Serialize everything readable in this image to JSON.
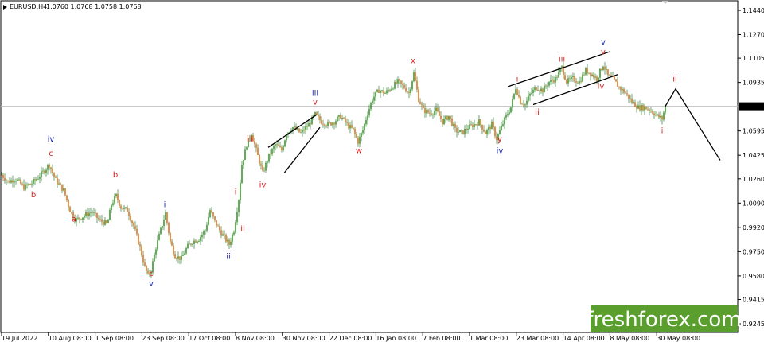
{
  "header": {
    "symbol": "EURUSD,H4",
    "ohlc": "1.0760 1.0768 1.0758 1.0768"
  },
  "brand": {
    "text": "freshforex.com"
  },
  "chart_data": {
    "type": "candlestick",
    "ylim": [
      0.9245,
      1.144
    ],
    "y_ticks": [
      "1.1440",
      "1.1270",
      "1.1105",
      "1.0935",
      "1.0768",
      "1.0595",
      "1.0425",
      "1.0260",
      "1.0090",
      "0.9920",
      "0.9750",
      "0.9580",
      "0.9415",
      "0.9245"
    ],
    "current_price": "1.0768",
    "x_ticks": [
      "19 Jul 2022",
      "10 Aug 08:00",
      "1 Sep 08:00",
      "23 Sep 08:00",
      "17 Oct 08:00",
      "8 Nov 08:00",
      "30 Nov 08:00",
      "22 Dec 08:00",
      "16 Jan 08:00",
      "7 Feb 08:00",
      "1 Mar 08:00",
      "23 Mar 08:00",
      "14 Apr 08:00",
      "8 May 08:00",
      "30 May 08:00"
    ],
    "price_path": [
      [
        0,
        1.03
      ],
      [
        10,
        1.024
      ],
      [
        20,
        1.026
      ],
      [
        30,
        1.02
      ],
      [
        40,
        1.023
      ],
      [
        50,
        1.028
      ],
      [
        62,
        1.036
      ],
      [
        70,
        1.025
      ],
      [
        80,
        1.018
      ],
      [
        88,
        1.004
      ],
      [
        95,
        0.997
      ],
      [
        105,
        1.0
      ],
      [
        115,
        1.003
      ],
      [
        125,
        0.997
      ],
      [
        135,
        0.994
      ],
      [
        140,
        1.008
      ],
      [
        146,
        1.014
      ],
      [
        152,
        1.006
      ],
      [
        160,
        1.004
      ],
      [
        168,
        0.993
      ],
      [
        176,
        0.978
      ],
      [
        182,
        0.964
      ],
      [
        186,
        0.958
      ],
      [
        190,
        0.962
      ],
      [
        196,
        0.978
      ],
      [
        202,
        0.99
      ],
      [
        208,
        1.002
      ],
      [
        214,
        0.982
      ],
      [
        220,
        0.972
      ],
      [
        228,
        0.97
      ],
      [
        235,
        0.978
      ],
      [
        242,
        0.982
      ],
      [
        250,
        0.984
      ],
      [
        258,
        0.99
      ],
      [
        264,
        1.004
      ],
      [
        270,
        0.996
      ],
      [
        278,
        0.988
      ],
      [
        288,
        0.98
      ],
      [
        294,
        0.99
      ],
      [
        300,
        1.012
      ],
      [
        304,
        1.036
      ],
      [
        310,
        1.05
      ],
      [
        316,
        1.058
      ],
      [
        322,
        1.046
      ],
      [
        330,
        1.03
      ],
      [
        338,
        1.042
      ],
      [
        346,
        1.05
      ],
      [
        354,
        1.046
      ],
      [
        360,
        1.058
      ],
      [
        368,
        1.062
      ],
      [
        378,
        1.058
      ],
      [
        388,
        1.064
      ],
      [
        396,
        1.071
      ],
      [
        404,
        1.066
      ],
      [
        412,
        1.064
      ],
      [
        420,
        1.066
      ],
      [
        428,
        1.07
      ],
      [
        436,
        1.064
      ],
      [
        444,
        1.06
      ],
      [
        450,
        1.052
      ],
      [
        456,
        1.06
      ],
      [
        462,
        1.072
      ],
      [
        468,
        1.082
      ],
      [
        476,
        1.088
      ],
      [
        484,
        1.086
      ],
      [
        492,
        1.09
      ],
      [
        500,
        1.094
      ],
      [
        508,
        1.09
      ],
      [
        514,
        1.086
      ],
      [
        520,
        1.1
      ],
      [
        526,
        1.082
      ],
      [
        532,
        1.074
      ],
      [
        540,
        1.072
      ],
      [
        548,
        1.074
      ],
      [
        556,
        1.066
      ],
      [
        564,
        1.07
      ],
      [
        572,
        1.06
      ],
      [
        580,
        1.058
      ],
      [
        588,
        1.062
      ],
      [
        596,
        1.064
      ],
      [
        602,
        1.066
      ],
      [
        610,
        1.058
      ],
      [
        618,
        1.064
      ],
      [
        624,
        1.054
      ],
      [
        630,
        1.062
      ],
      [
        636,
        1.07
      ],
      [
        642,
        1.076
      ],
      [
        648,
        1.09
      ],
      [
        654,
        1.08
      ],
      [
        660,
        1.078
      ],
      [
        666,
        1.085
      ],
      [
        674,
        1.09
      ],
      [
        682,
        1.088
      ],
      [
        690,
        1.094
      ],
      [
        698,
        1.096
      ],
      [
        706,
        1.104
      ],
      [
        712,
        1.094
      ],
      [
        720,
        1.096
      ],
      [
        728,
        1.094
      ],
      [
        736,
        1.102
      ],
      [
        742,
        1.1
      ],
      [
        750,
        1.096
      ],
      [
        758,
        1.106
      ],
      [
        764,
        1.098
      ],
      [
        770,
        1.096
      ],
      [
        778,
        1.09
      ],
      [
        786,
        1.086
      ],
      [
        794,
        1.08
      ],
      [
        802,
        1.076
      ],
      [
        810,
        1.076
      ],
      [
        818,
        1.074
      ],
      [
        826,
        1.07
      ],
      [
        832,
        1.068
      ],
      [
        836,
        1.077
      ]
    ],
    "forecast": [
      [
        836,
        1.0768
      ],
      [
        849,
        1.089
      ],
      [
        905,
        1.039
      ]
    ],
    "channels": [
      {
        "name": "wedge-1",
        "lines": [
          [
            [
              337,
              1.048
            ],
            [
              398,
              1.071
            ]
          ],
          [
            [
              357,
              1.03
            ],
            [
              402,
              1.062
            ]
          ]
        ]
      },
      {
        "name": "channel-2",
        "lines": [
          [
            [
              638,
              1.0905
            ],
            [
              766,
              1.115
            ]
          ],
          [
            [
              670,
              1.078
            ],
            [
              776,
              1.099
            ]
          ]
        ]
      }
    ],
    "wave_labels": [
      {
        "t": "iv",
        "x": 64,
        "p": 1.052,
        "c": "#1f2bb0"
      },
      {
        "t": "c",
        "x": 64,
        "p": 1.042,
        "c": "#d81e1e"
      },
      {
        "t": "b",
        "x": 42,
        "p": 1.013,
        "c": "#d81e1e"
      },
      {
        "t": "a",
        "x": 93,
        "p": 0.996,
        "c": "#d81e1e"
      },
      {
        "t": "b",
        "x": 145,
        "p": 1.027,
        "c": "#d81e1e"
      },
      {
        "t": "c",
        "x": 190,
        "p": 0.958,
        "c": "#d81e1e"
      },
      {
        "t": "v",
        "x": 190,
        "p": 0.951,
        "c": "#1f2bb0"
      },
      {
        "t": "i",
        "x": 207,
        "p": 1.006,
        "c": "#1f2bb0"
      },
      {
        "t": "ii",
        "x": 287,
        "p": 0.97,
        "c": "#1f2bb0"
      },
      {
        "t": "i",
        "x": 296,
        "p": 1.015,
        "c": "#d81e1e"
      },
      {
        "t": "ii",
        "x": 305,
        "p": 0.989,
        "c": "#d81e1e"
      },
      {
        "t": "iii",
        "x": 314,
        "p": 1.052,
        "c": "#d81e1e"
      },
      {
        "t": "iv",
        "x": 330,
        "p": 1.02,
        "c": "#d81e1e"
      },
      {
        "t": "iii",
        "x": 396,
        "p": 1.084,
        "c": "#1f2bb0"
      },
      {
        "t": "v",
        "x": 396,
        "p": 1.078,
        "c": "#d81e1e"
      },
      {
        "t": "w",
        "x": 451,
        "p": 1.044,
        "c": "#d81e1e"
      },
      {
        "t": "x",
        "x": 519,
        "p": 1.107,
        "c": "#d81e1e"
      },
      {
        "t": "y",
        "x": 628,
        "p": 1.052,
        "c": "#d81e1e"
      },
      {
        "t": "iv",
        "x": 628,
        "p": 1.044,
        "c": "#1f2bb0"
      },
      {
        "t": "i",
        "x": 650,
        "p": 1.094,
        "c": "#d81e1e"
      },
      {
        "t": "ii",
        "x": 675,
        "p": 1.071,
        "c": "#d81e1e"
      },
      {
        "t": "iii",
        "x": 706,
        "p": 1.108,
        "c": "#d81e1e"
      },
      {
        "t": "iv",
        "x": 755,
        "p": 1.089,
        "c": "#d81e1e"
      },
      {
        "t": "v",
        "x": 758,
        "p": 1.12,
        "c": "#1f2bb0"
      },
      {
        "t": "v",
        "x": 758,
        "p": 1.113,
        "c": "#d81e1e"
      },
      {
        "t": "i",
        "x": 832,
        "p": 1.058,
        "c": "#d81e1e"
      },
      {
        "t": "ii",
        "x": 848,
        "p": 1.094,
        "c": "#d81e1e"
      }
    ],
    "colors": {
      "bull": "#3a9a2e",
      "bear": "#e2731e",
      "wick": "#2e7d32",
      "line": "#000000",
      "wave_red": "#d81e1e",
      "wave_blue": "#1f2bb0",
      "brand_bg": "#5a9e2d"
    }
  }
}
